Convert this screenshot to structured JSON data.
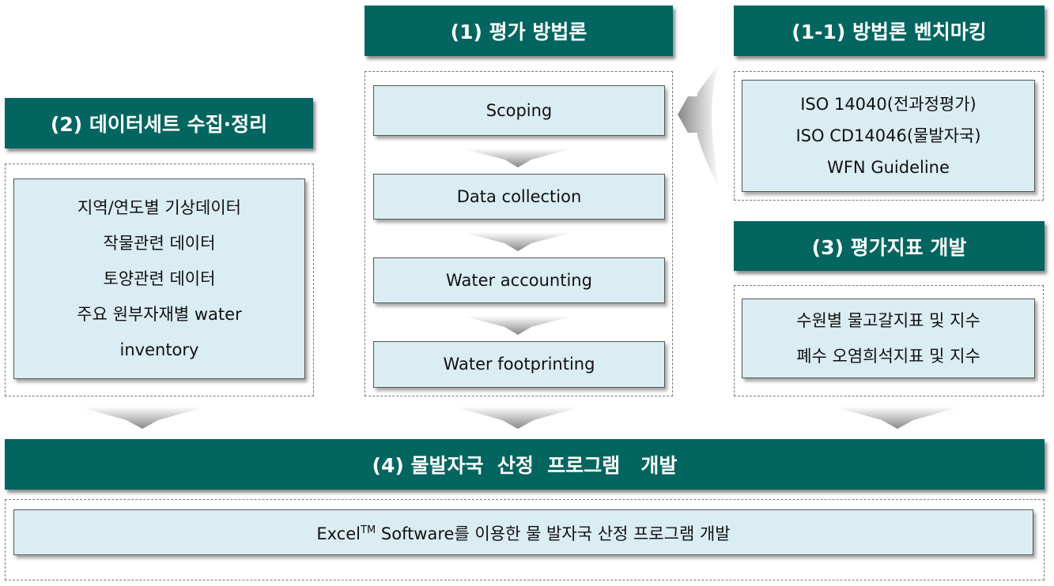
{
  "colors": {
    "header": "#03655f",
    "box": "#daedf2",
    "arrow": "#999999"
  },
  "methodology": {
    "title": "(1) 평가 방법론",
    "steps": [
      "Scoping",
      "Data collection",
      "Water accounting",
      "Water footprinting"
    ]
  },
  "benchmark": {
    "title": "(1-1) 방법론 벤치마킹",
    "items": [
      "ISO 14040(전과정평가)",
      "ISO CD14046(물발자국)",
      "WFN Guideline"
    ]
  },
  "dataset": {
    "title": "(2) 데이터세트 수집·정리",
    "items": [
      "지역/연도별 기상데이터",
      "작물관련 데이터",
      "토양관련 데이터",
      "주요 원부자재별 water",
      "inventory"
    ]
  },
  "indicators": {
    "title": "(3) 평가지표 개발",
    "items": [
      "수원별 물고갈지표 및 지수",
      "폐수 오염희석지표 및 지수"
    ]
  },
  "program": {
    "title": "(4) 물발자국  산정  프로그램   개발",
    "text_pre": "Excel",
    "text_sup": "TM",
    "text_post": " Software를 이용한 물 발자국 산정 프로그램 개발"
  }
}
